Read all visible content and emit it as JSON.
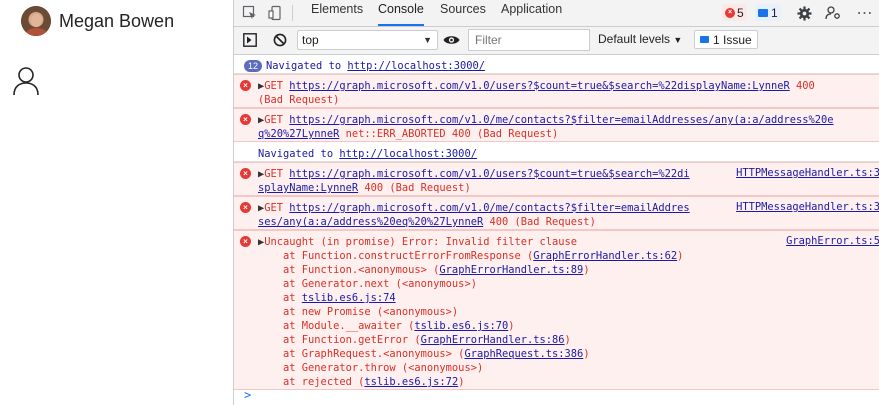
{
  "app": {
    "user_name": "Megan Bowen",
    "avatar_icon": "user-avatar-photo",
    "person_icon": "person-outline-icon"
  },
  "devtools": {
    "tabs": [
      "Elements",
      "Console",
      "Sources",
      "Application"
    ],
    "active_tab": "Console",
    "error_count": "5",
    "message_count": "1",
    "toolbar": {
      "context": "top",
      "filter_placeholder": "Filter",
      "levels": "Default levels",
      "issues": "1 Issue"
    },
    "colors": {
      "accent": "#1a73e8",
      "error_bg": "#fff0f0",
      "error_text": "#d93026",
      "link": "#1a1aa6"
    },
    "console": {
      "nav1_count": "12",
      "nav1_text": "Navigated to ",
      "nav1_link": "http://localhost:3000/",
      "e1_method": "GET ",
      "e1_url": "https://graph.microsoft.com/v1.0/users?$count=true&$search=%22displayName:LynneR",
      "e1_status_a": " 400",
      "e1_status_b": "(Bad Request)",
      "e2_method": "GET ",
      "e2_url_a": "https://graph.microsoft.com/v1.0/me/contacts?$filter=emailAddresses/any(a:a/address%20e",
      "e2_url_b": "q%20%27LynneR",
      "e2_status": " net::ERR_ABORTED 400 (Bad Request)",
      "nav2_text": "Navigated to ",
      "nav2_link": "http://localhost:3000/",
      "e3_method": "GET ",
      "e3_url_a": "https://graph.microsoft.com/v1.0/users?$count=true&$search=%22di",
      "e3_url_b": "splayName:LynneR",
      "e3_status": " 400 (Bad Request)",
      "e3_src": "HTTPMessageHandler.ts:3",
      "e4_method": "GET ",
      "e4_url_a": "https://graph.microsoft.com/v1.0/me/contacts?$filter=emailAddres",
      "e4_url_b": "ses/any(a:a/address%20eq%20%27LynneR",
      "e4_status": " 400 (Bad Request)",
      "e4_src": "HTTPMessageHandler.ts:3",
      "e5_title": "Uncaught (in promise) Error: Invalid filter clause",
      "e5_src": "GraphError.ts:5",
      "stack": [
        {
          "pre": "    at Function.constructErrorFromResponse (",
          "link": "GraphErrorHandler.ts:62",
          "post": ")"
        },
        {
          "pre": "    at Function.<anonymous> (",
          "link": "GraphErrorHandler.ts:89",
          "post": ")"
        },
        {
          "pre": "    at Generator.next (<anonymous>)",
          "link": "",
          "post": ""
        },
        {
          "pre": "    at ",
          "link": "tslib.es6.js:74",
          "post": ""
        },
        {
          "pre": "    at new Promise (<anonymous>)",
          "link": "",
          "post": ""
        },
        {
          "pre": "    at Module.__awaiter (",
          "link": "tslib.es6.js:70",
          "post": ")"
        },
        {
          "pre": "    at Function.getError (",
          "link": "GraphErrorHandler.ts:86",
          "post": ")"
        },
        {
          "pre": "    at GraphRequest.<anonymous> (",
          "link": "GraphRequest.ts:386",
          "post": ")"
        },
        {
          "pre": "    at Generator.throw (<anonymous>)",
          "link": "",
          "post": ""
        },
        {
          "pre": "    at rejected (",
          "link": "tslib.es6.js:72",
          "post": ")"
        }
      ],
      "prompt": ">"
    }
  }
}
